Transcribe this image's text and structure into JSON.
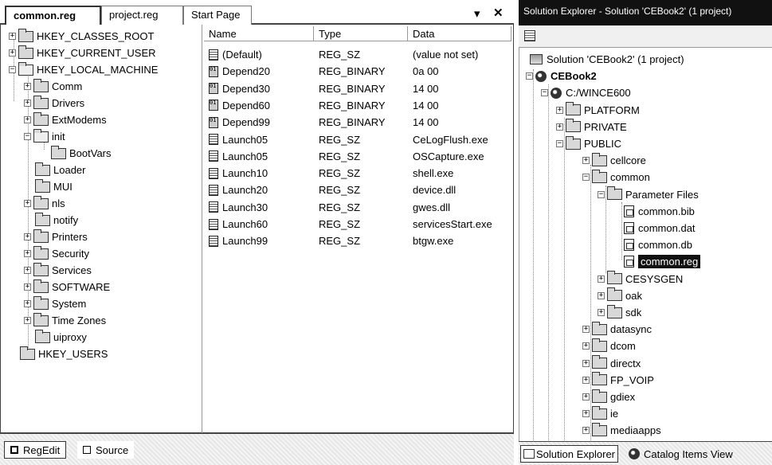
{
  "editor": {
    "tabs": [
      "common.reg",
      "project.reg",
      "Start Page"
    ],
    "dropdown_glyph": "▾",
    "close_glyph": "✕"
  },
  "keys": [
    {
      "label": "HKEY_CLASSES_ROOT"
    },
    {
      "label": "HKEY_CURRENT_USER"
    },
    {
      "label": "HKEY_LOCAL_MACHINE"
    },
    {
      "label": "Comm"
    },
    {
      "label": "Drivers"
    },
    {
      "label": "ExtModems"
    },
    {
      "label": "init"
    },
    {
      "label": "BootVars"
    },
    {
      "label": "Loader"
    },
    {
      "label": "MUI"
    },
    {
      "label": "nls"
    },
    {
      "label": "notify"
    },
    {
      "label": "Printers"
    },
    {
      "label": "Security"
    },
    {
      "label": "Services"
    },
    {
      "label": "SOFTWARE"
    },
    {
      "label": "System"
    },
    {
      "label": "Time Zones"
    },
    {
      "label": "uiproxy"
    },
    {
      "label": "HKEY_USERS"
    }
  ],
  "values_table": {
    "columns": [
      "Name",
      "Type",
      "Data"
    ],
    "rows": [
      {
        "name": "(Default)",
        "type": "REG_SZ",
        "data": "(value not set)",
        "kind": "sz"
      },
      {
        "name": "Depend20",
        "type": "REG_BINARY",
        "data": "0a 00",
        "kind": "bin"
      },
      {
        "name": "Depend30",
        "type": "REG_BINARY",
        "data": "14 00",
        "kind": "bin"
      },
      {
        "name": "Depend60",
        "type": "REG_BINARY",
        "data": "14 00",
        "kind": "bin"
      },
      {
        "name": "Depend99",
        "type": "REG_BINARY",
        "data": "14 00",
        "kind": "bin"
      },
      {
        "name": "Launch05",
        "type": "REG_SZ",
        "data": "CeLogFlush.exe",
        "kind": "sz"
      },
      {
        "name": "Launch05",
        "type": "REG_SZ",
        "data": "OSCapture.exe",
        "kind": "sz"
      },
      {
        "name": "Launch10",
        "type": "REG_SZ",
        "data": "shell.exe",
        "kind": "sz"
      },
      {
        "name": "Launch20",
        "type": "REG_SZ",
        "data": "device.dll",
        "kind": "sz"
      },
      {
        "name": "Launch30",
        "type": "REG_SZ",
        "data": "gwes.dll",
        "kind": "sz"
      },
      {
        "name": "Launch60",
        "type": "REG_SZ",
        "data": "servicesStart.exe",
        "kind": "sz"
      },
      {
        "name": "Launch99",
        "type": "REG_SZ",
        "data": "btgw.exe",
        "kind": "sz"
      }
    ]
  },
  "bottom_tabs": [
    "RegEdit",
    "Source"
  ],
  "solution_explorer": {
    "title": "Solution Explorer - Solution 'CEBook2' (1 project)",
    "toolbar_icon": "properties-icon",
    "nodes": [
      {
        "label": "Solution 'CEBook2' (1 project)"
      },
      {
        "label": "CEBook2"
      },
      {
        "label": "C:/WINCE600"
      },
      {
        "label": "PLATFORM"
      },
      {
        "label": "PRIVATE"
      },
      {
        "label": "PUBLIC"
      },
      {
        "label": "cellcore"
      },
      {
        "label": "common"
      },
      {
        "label": "Parameter Files"
      },
      {
        "label": "common.bib"
      },
      {
        "label": "common.dat"
      },
      {
        "label": "common.db"
      },
      {
        "label": "common.reg"
      },
      {
        "label": "CESYSGEN"
      },
      {
        "label": "oak"
      },
      {
        "label": "sdk"
      },
      {
        "label": "datasync"
      },
      {
        "label": "dcom"
      },
      {
        "label": "directx"
      },
      {
        "label": "FP_VOIP"
      },
      {
        "label": "gdiex"
      },
      {
        "label": "ie"
      },
      {
        "label": "mediaapps"
      }
    ],
    "bottom_tabs": [
      "Solution Explorer",
      "Catalog Items View"
    ]
  }
}
